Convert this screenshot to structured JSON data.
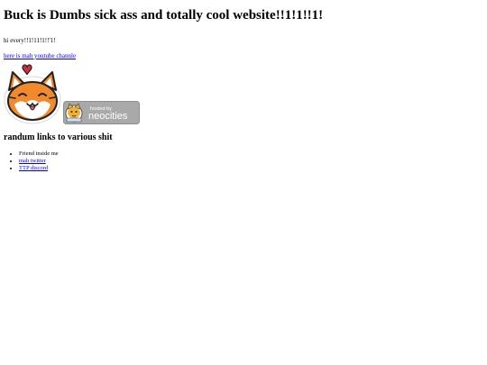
{
  "page": {
    "title": "Buck is Dumbs sick ass and totally cool website!!1!1!!1!",
    "greeting": "hi every!!1!11!1!!'1!",
    "youtube_link": "here is mah youtube channle",
    "links_heading": "randum links to various shit",
    "links": [
      {
        "label": "Friend inside me",
        "is_link": false
      },
      {
        "label": "mah twitter",
        "is_link": true
      },
      {
        "label": "TTP discord",
        "is_link": true
      }
    ]
  },
  "badge": {
    "small_text": "hosted by",
    "brand_text": "neocities"
  },
  "colors": {
    "cat_orange": "#f08a2c",
    "heart_red": "#d0303c",
    "badge_gray": "#a9a9a9",
    "link_blue": "#0000ee"
  },
  "icons": {
    "cat": "cat-face-sticker",
    "heart": "heart-icon",
    "badge": "neocities-badge"
  }
}
